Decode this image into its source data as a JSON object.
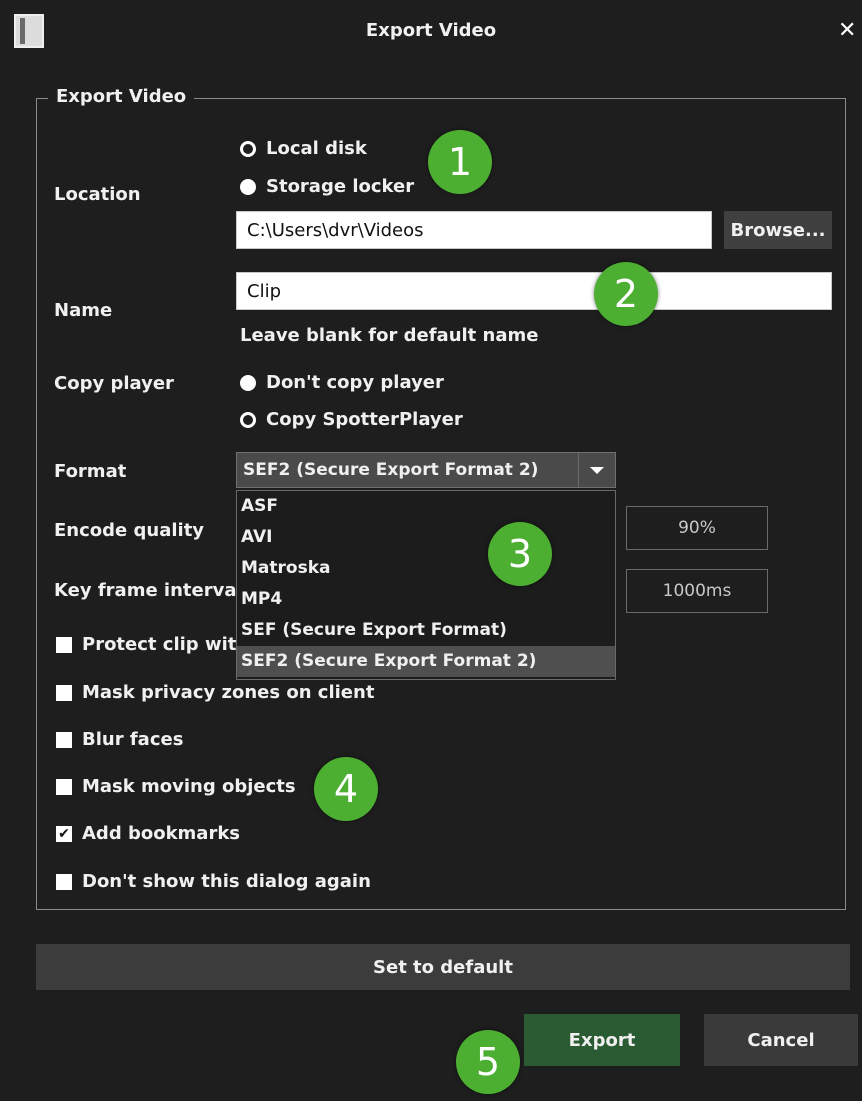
{
  "window": {
    "title": "Export Video",
    "close_symbol": "✕"
  },
  "group": {
    "legend": "Export Video"
  },
  "location": {
    "label": "Location",
    "options": [
      {
        "label": "Local disk",
        "selected": false
      },
      {
        "label": "Storage locker",
        "selected": true
      }
    ],
    "path_value": "C:\\Users\\dvr\\Videos",
    "browse_label": "Browse..."
  },
  "name": {
    "label": "Name",
    "value": "Clip",
    "hint": "Leave blank for default name"
  },
  "copy_player": {
    "label": "Copy player",
    "options": [
      {
        "label": "Don't copy player",
        "selected": true
      },
      {
        "label": "Copy SpotterPlayer",
        "selected": false
      }
    ]
  },
  "format": {
    "label": "Format",
    "selected": "SEF2 (Secure Export Format 2)",
    "options": [
      "ASF",
      "AVI",
      "Matroska",
      "MP4",
      "SEF (Secure Export Format)",
      "SEF2 (Secure Export Format 2)"
    ]
  },
  "encode_quality": {
    "label": "Encode quality",
    "value": "90%"
  },
  "key_frame_interval": {
    "label": "Key frame interval",
    "value": "1000ms"
  },
  "checkboxes": [
    {
      "label": "Protect clip with",
      "checked": false
    },
    {
      "label": "Mask privacy zones on client",
      "checked": false
    },
    {
      "label": "Blur faces",
      "checked": false
    },
    {
      "label": "Mask moving objects",
      "checked": false
    },
    {
      "label": "Add bookmarks",
      "checked": true
    },
    {
      "label": "Don't show this dialog again",
      "checked": false
    }
  ],
  "buttons": {
    "set_default": "Set to default",
    "export": "Export",
    "cancel": "Cancel"
  },
  "badges": [
    "1",
    "2",
    "3",
    "4",
    "5"
  ],
  "colors": {
    "background": "#1e1e1e",
    "export_button": "#2b5b33",
    "badge": "#4caf32",
    "selected_option": "#4f4f4f"
  }
}
